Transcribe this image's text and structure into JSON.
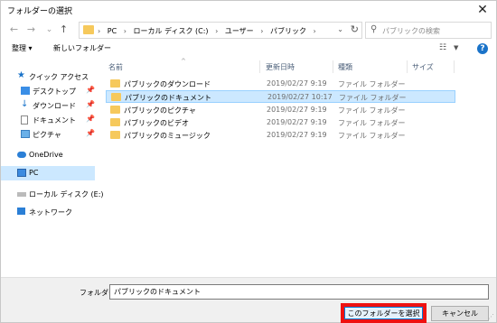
{
  "window": {
    "title": "フォルダーの選択",
    "close_glyph": "✕"
  },
  "nav": {
    "back_glyph": "←",
    "forward_glyph": "→",
    "recent_glyph": "⌄",
    "up_glyph": "↑"
  },
  "address": {
    "crumbs": [
      "PC",
      "ローカル ディスク (C:)",
      "ユーザー",
      "パブリック"
    ],
    "separator": "›"
  },
  "search": {
    "placeholder": "パブリックの検索"
  },
  "toolbar": {
    "organize_label": "整理 ▾",
    "new_folder_label": "新しいフォルダー"
  },
  "sidebar": {
    "items": [
      {
        "label": "クイック アクセス",
        "icon": "star-icon",
        "pinned": false
      },
      {
        "label": "デスクトップ",
        "icon": "desktop-icon",
        "pinned": true
      },
      {
        "label": "ダウンロード",
        "icon": "download-icon",
        "pinned": true
      },
      {
        "label": "ドキュメント",
        "icon": "document-icon",
        "pinned": true
      },
      {
        "label": "ピクチャ",
        "icon": "pictures-icon",
        "pinned": true
      },
      {
        "label": "OneDrive",
        "icon": "cloud-icon",
        "pinned": false
      },
      {
        "label": "PC",
        "icon": "computer-icon",
        "pinned": false,
        "selected": true
      },
      {
        "label": "ローカル ディスク (E:)",
        "icon": "drive-icon",
        "pinned": false
      },
      {
        "label": "ネットワーク",
        "icon": "network-icon",
        "pinned": false
      }
    ]
  },
  "columns": {
    "name": "名前",
    "date": "更新日時",
    "type": "種類",
    "size": "サイズ"
  },
  "files": [
    {
      "name": "パブリックのダウンロード",
      "date": "2019/02/27 9:19",
      "type": "ファイル フォルダー"
    },
    {
      "name": "パブリックのドキュメント",
      "date": "2019/02/27 10:17",
      "type": "ファイル フォルダー",
      "selected": true
    },
    {
      "name": "パブリックのピクチャ",
      "date": "2019/02/27 9:19",
      "type": "ファイル フォルダー"
    },
    {
      "name": "パブリックのビデオ",
      "date": "2019/02/27 9:19",
      "type": "ファイル フォルダー"
    },
    {
      "name": "パブリックのミュージック",
      "date": "2019/02/27 9:19",
      "type": "ファイル フォルダー"
    }
  ],
  "footer": {
    "folder_label": "フォルダー:",
    "folder_value": "パブリックのドキュメント",
    "select_button": "このフォルダーを選択",
    "cancel_button": "キャンセル"
  },
  "colors": {
    "selection": "#cce8ff",
    "highlight_border": "#ee1111",
    "folder": "#f6c95c"
  }
}
